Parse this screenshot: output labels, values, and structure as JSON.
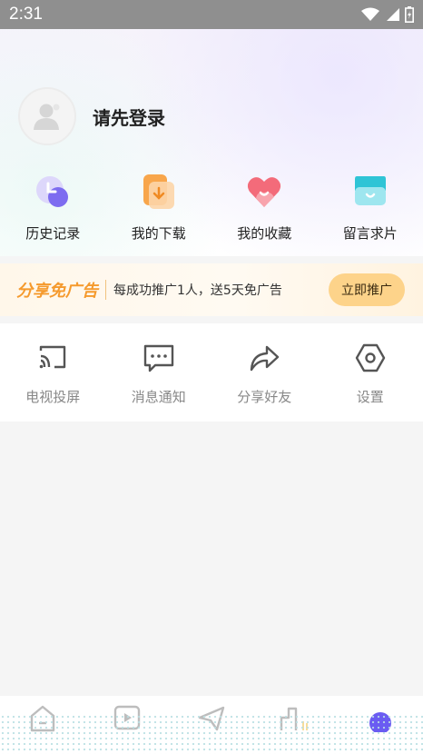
{
  "status_bar": {
    "time": "2:31",
    "icons": [
      "wifi-icon",
      "signal-icon",
      "battery-icon"
    ]
  },
  "profile": {
    "avatar_icon": "user-avatar-icon",
    "login_prompt": "请先登录"
  },
  "quick_actions": [
    {
      "label": "历史记录",
      "icon": "history-clock-icon",
      "color": "#8b7cf6"
    },
    {
      "label": "我的下载",
      "icon": "download-icon",
      "color": "#f7a14a"
    },
    {
      "label": "我的收藏",
      "icon": "favorite-heart-icon",
      "color": "#f36b7a"
    },
    {
      "label": "留言求片",
      "icon": "message-box-icon",
      "color": "#35c8d9"
    }
  ],
  "promo": {
    "brand": "分享免广告",
    "text": "每成功推广1人，送5天免广告",
    "button": "立即推广",
    "accent_color": "#f59a2d",
    "button_color": "#fdd38a"
  },
  "tools": [
    {
      "label": "电视投屏",
      "icon": "cast-screen-icon"
    },
    {
      "label": "消息通知",
      "icon": "message-notification-icon"
    },
    {
      "label": "分享好友",
      "icon": "share-icon"
    },
    {
      "label": "设置",
      "icon": "settings-icon"
    }
  ],
  "bottom_nav": [
    {
      "icon": "home-icon"
    },
    {
      "icon": "video-play-icon"
    },
    {
      "icon": "send-icon"
    },
    {
      "icon": "ranking-icon"
    },
    {
      "icon": "profile-tab-icon"
    }
  ]
}
